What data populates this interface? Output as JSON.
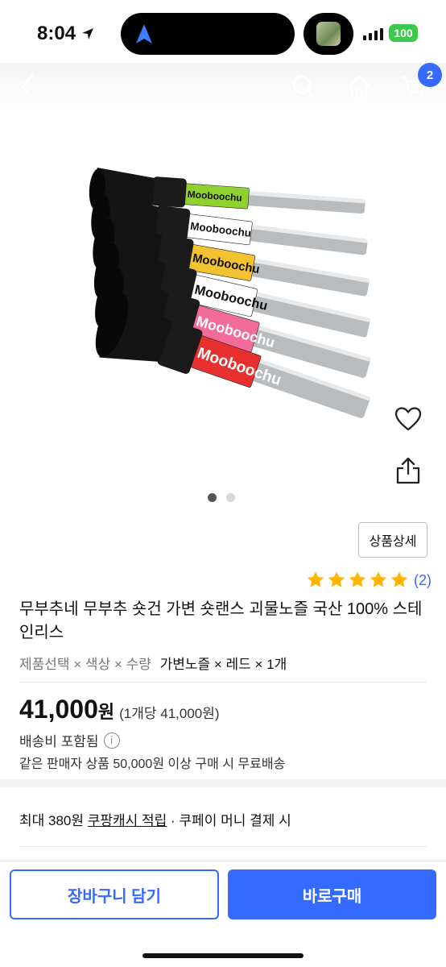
{
  "status": {
    "time": "8:04",
    "battery": "100"
  },
  "header": {
    "cart_count": "2"
  },
  "product": {
    "title": "무부추네 무부추 숏건 가변 숏랜스 괴물노즐 국산 100% 스테인리스",
    "brand_label": "Mooboochu",
    "colors": [
      "#8fd12e",
      "#ffffff",
      "#f2c230",
      "#ffffff",
      "#f36b9a",
      "#e8312f"
    ],
    "detail_button": "상품상세",
    "rating": 5,
    "review_count": "(2)"
  },
  "options": {
    "labels": "제품선택 × 색상 × 수량",
    "selected": "가변노즐 × 레드 × 1개"
  },
  "price": {
    "amount": "41,000",
    "currency": "원",
    "unit_price": "(1개당 41,000원)"
  },
  "shipping": {
    "included": "배송비 포함됨",
    "free_condition": "같은 판매자 상품 50,000원 이상 구매 시 무료배송"
  },
  "cash": {
    "prefix": "최대 380원 ",
    "link": "쿠팡캐시 적립",
    "suffix": " · 쿠페이 머니 결제 시"
  },
  "actions": {
    "cart": "장바구니 담기",
    "buy": "바로구매"
  }
}
